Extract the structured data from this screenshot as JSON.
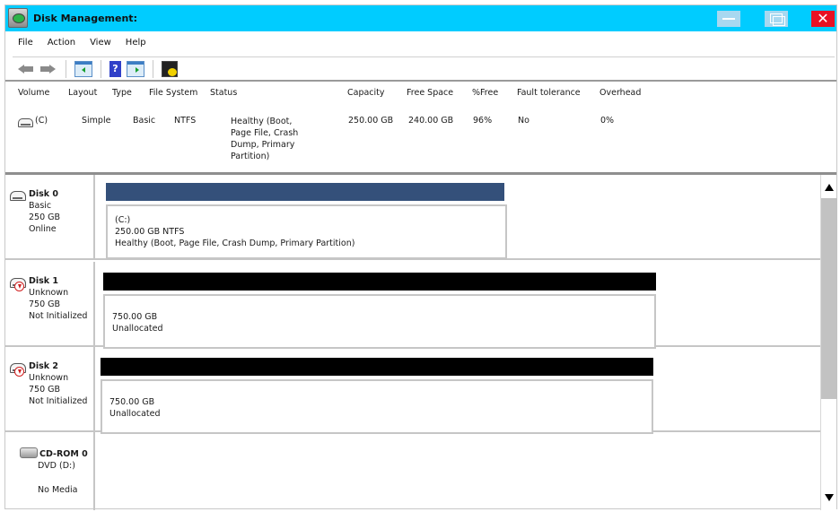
{
  "window": {
    "title": "Disk Management:",
    "title_bar_color": "#00ccff",
    "controls": {
      "minimize": "minimize",
      "maximize": "restore",
      "close": "✕"
    }
  },
  "menu": {
    "items": [
      {
        "label": "File"
      },
      {
        "label": "Action"
      },
      {
        "label": "View"
      },
      {
        "label": "Help"
      }
    ]
  },
  "toolbar": {
    "buttons": [
      {
        "icon": "back-arrow-icon"
      },
      {
        "icon": "forward-arrow-icon"
      },
      {
        "icon": "show-hide-console-tree-icon"
      },
      {
        "icon": "help-icon",
        "glyph": "?"
      },
      {
        "icon": "show-hide-action-pane-icon"
      },
      {
        "icon": "properties-icon"
      }
    ]
  },
  "volume_list": {
    "columns": [
      "Volume",
      "Layout",
      "Type",
      "File System",
      "Status",
      "Capacity",
      "Free Space",
      "%Free",
      "Fault tolerance",
      "Overhead"
    ],
    "rows": [
      {
        "volume": "(C)",
        "layout": "Simple",
        "type": "Basic",
        "file_system": "NTFS",
        "status_lines": [
          "Healthy (Boot,",
          "Page File, Crash",
          "Dump, Primary",
          "Partition)"
        ],
        "capacity": "250.00 GB",
        "free_space": "240.00 GB",
        "percent_free": "96%",
        "fault_tolerance": "No",
        "overhead": "0%"
      }
    ]
  },
  "disks": [
    {
      "name": "Disk 0",
      "type": "Basic",
      "size": "250 GB",
      "state": "Online",
      "partition": {
        "bar_color": "#34507a",
        "lines": [
          "(C:)",
          "250.00 GB  NTFS",
          "Healthy (Boot, Page File, Crash Dump, Primary Partition)"
        ]
      }
    },
    {
      "name": "Disk 1",
      "type": "Unknown",
      "size": "750 GB",
      "state": "Not Initialized",
      "partition": {
        "bar_color": "#000000",
        "lines": [
          "750.00 GB",
          "Unallocated"
        ]
      }
    },
    {
      "name": "Disk 2",
      "type": "Unknown",
      "size": "750 GB",
      "state": "Not Initialized",
      "partition": {
        "bar_color": "#000000",
        "lines": [
          "750.00 GB",
          "Unallocated"
        ]
      }
    },
    {
      "name": "CD-ROM 0",
      "type": "DVD (D:)",
      "state": "No Media"
    }
  ],
  "scrollbar": {
    "up": "▲",
    "down": "▼"
  }
}
